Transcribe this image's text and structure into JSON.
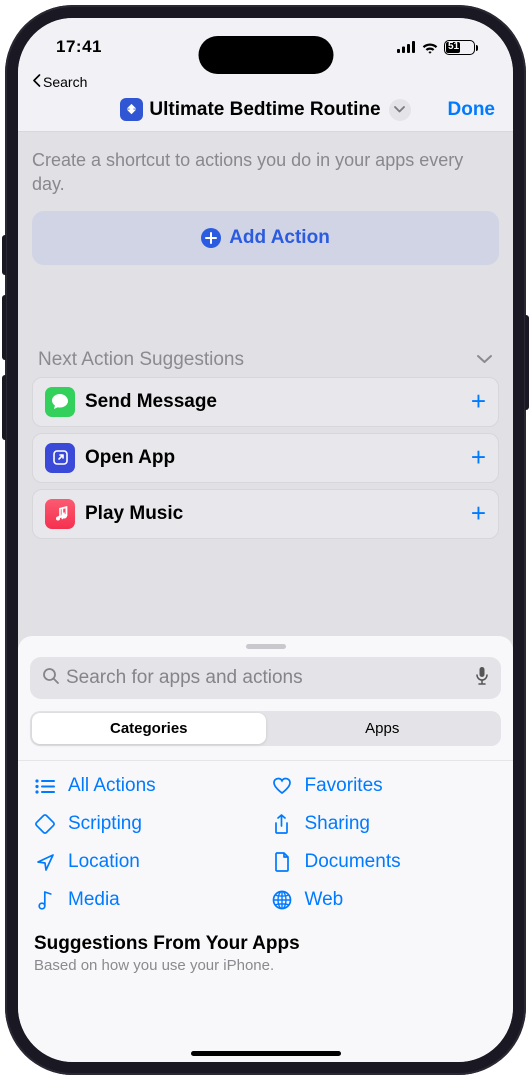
{
  "statusbar": {
    "time": "17:41",
    "battery_pct": 51
  },
  "nav": {
    "back_label": "Search",
    "title": "Ultimate Bedtime Routine",
    "done_label": "Done"
  },
  "main": {
    "hint": "Create a shortcut to actions you do in your apps every day.",
    "add_action_label": "Add Action"
  },
  "suggestions": {
    "header": "Next Action Suggestions",
    "items": [
      {
        "label": "Send Message",
        "icon": "messages-icon"
      },
      {
        "label": "Open App",
        "icon": "open-app-icon"
      },
      {
        "label": "Play Music",
        "icon": "music-icon"
      }
    ]
  },
  "sheet": {
    "search_placeholder": "Search for apps and actions",
    "segments": {
      "categories": "Categories",
      "apps": "Apps"
    },
    "categories": [
      {
        "label": "All Actions",
        "icon": "list-icon"
      },
      {
        "label": "Favorites",
        "icon": "heart-icon"
      },
      {
        "label": "Scripting",
        "icon": "scripting-icon"
      },
      {
        "label": "Sharing",
        "icon": "share-icon"
      },
      {
        "label": "Location",
        "icon": "location-icon"
      },
      {
        "label": "Documents",
        "icon": "document-icon"
      },
      {
        "label": "Media",
        "icon": "media-icon"
      },
      {
        "label": "Web",
        "icon": "web-icon"
      }
    ],
    "bottom": {
      "title": "Suggestions From Your Apps",
      "subtitle": "Based on how you use your iPhone."
    }
  }
}
